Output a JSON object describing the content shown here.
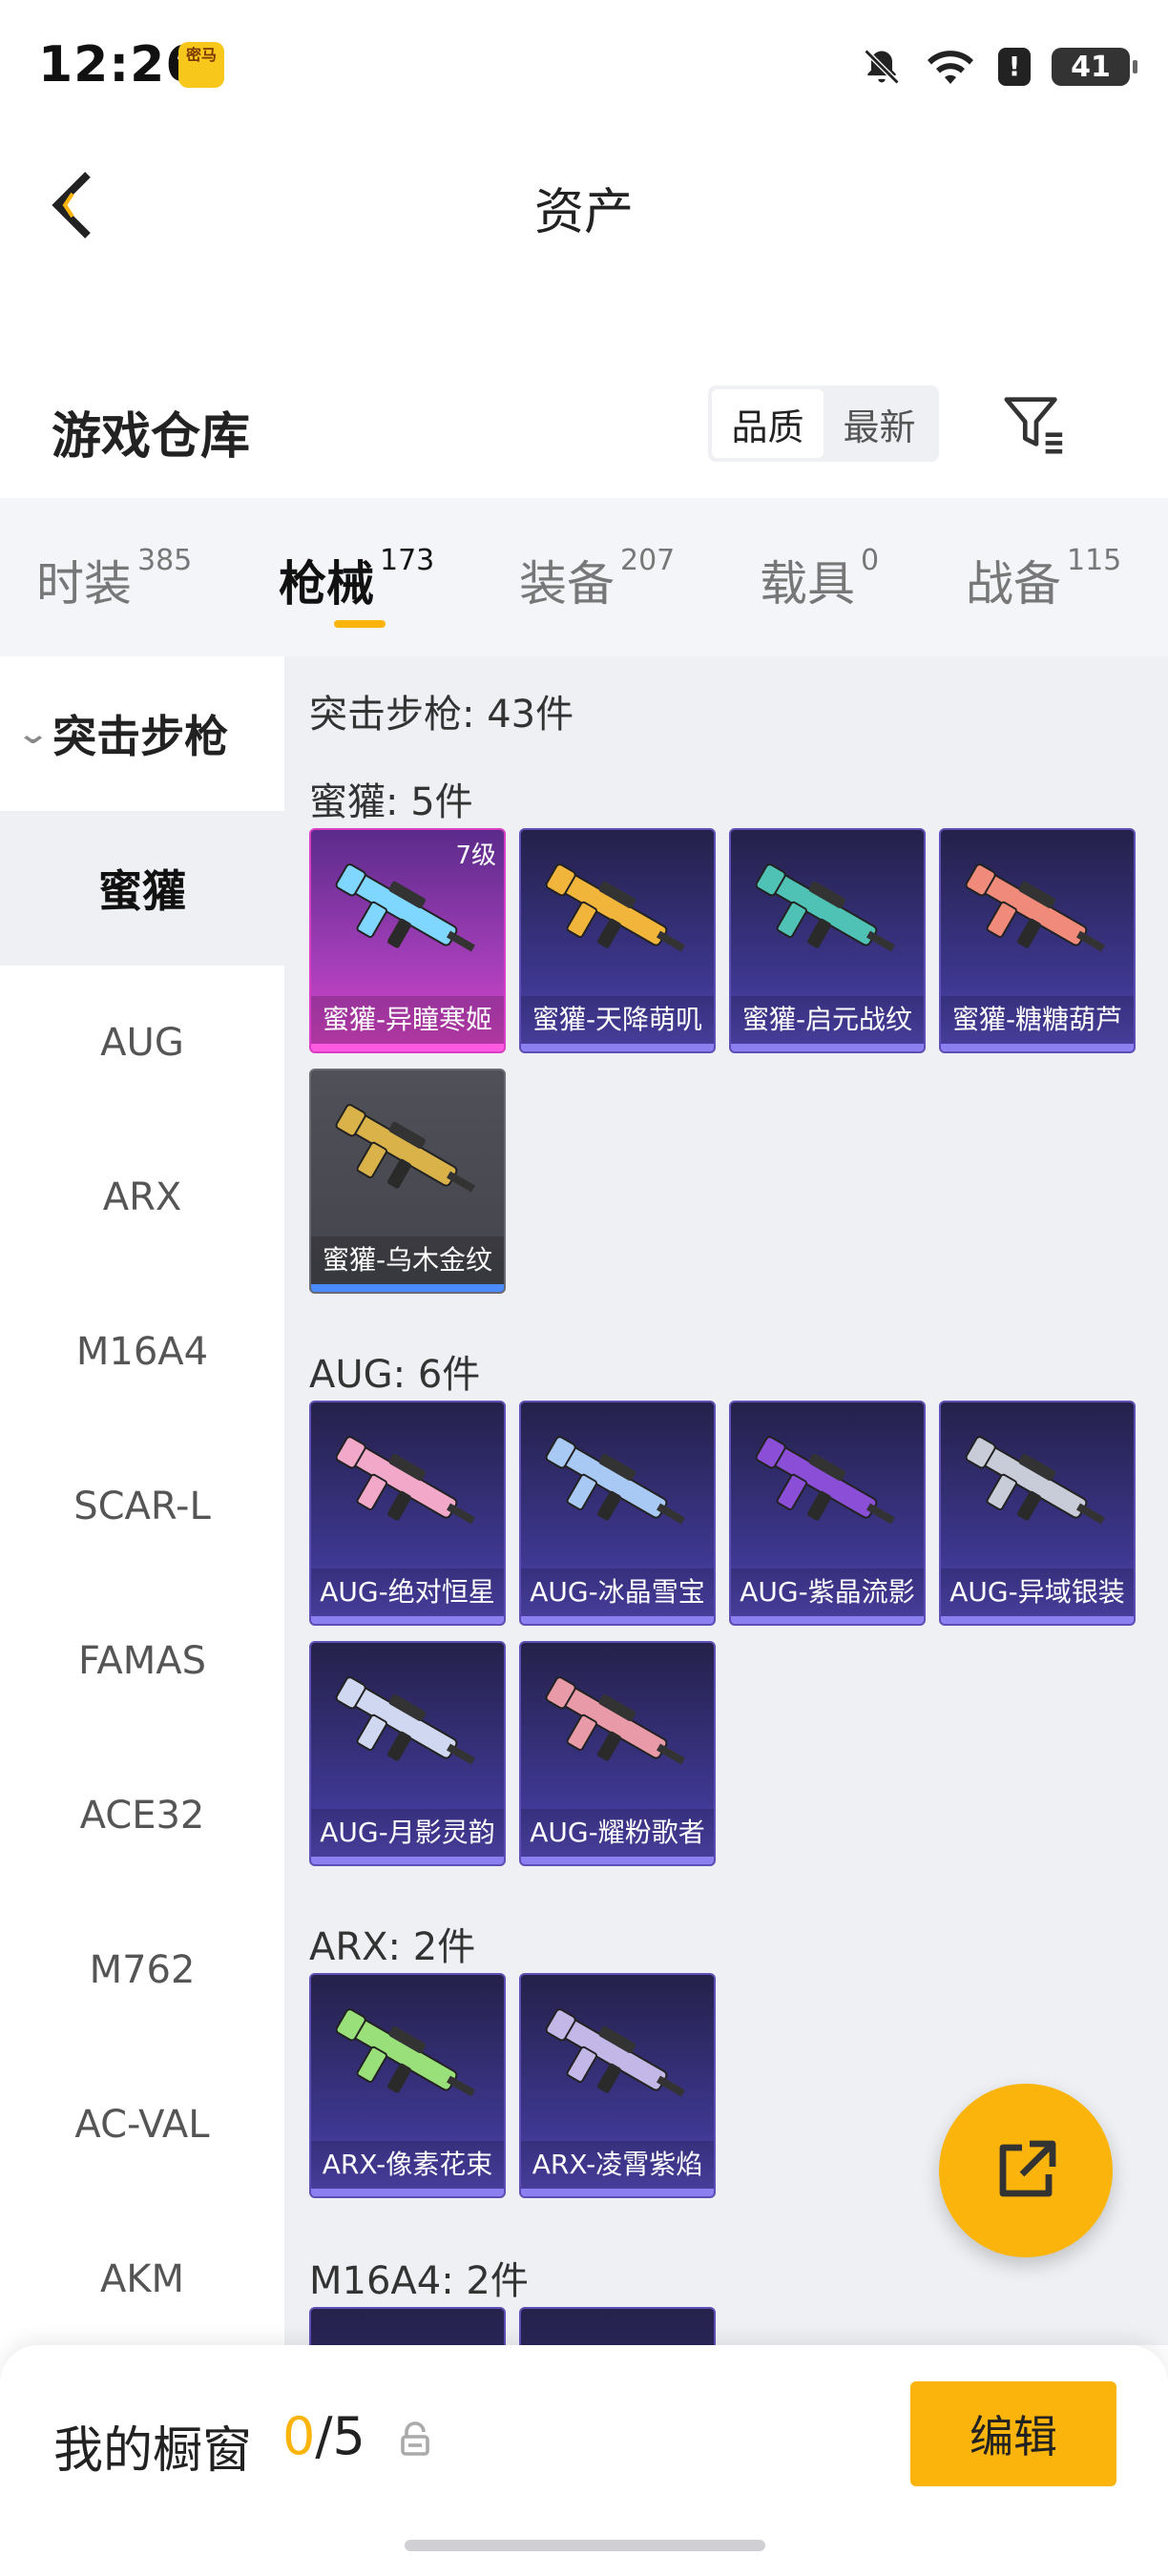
{
  "status": {
    "time": "12:26",
    "battery": "41",
    "app_badge": "密马"
  },
  "header": {
    "title": "资产"
  },
  "warehouse": {
    "title": "游戏仓库",
    "sort_options": [
      "品质",
      "最新"
    ]
  },
  "tabs": [
    {
      "label": "时装",
      "count": "385"
    },
    {
      "label": "枪械",
      "count": "173"
    },
    {
      "label": "装备",
      "count": "207"
    },
    {
      "label": "载具",
      "count": "0"
    },
    {
      "label": "战备",
      "count": "115"
    }
  ],
  "sidebar": {
    "group": "突击步枪",
    "items": [
      "蜜獾",
      "AUG",
      "ARX",
      "M16A4",
      "SCAR-L",
      "FAMAS",
      "ACE32",
      "M762",
      "AC-VAL",
      "AKM"
    ]
  },
  "main": {
    "summary": "突击步枪: 43件",
    "sections": [
      {
        "title": "蜜獾: 5件",
        "items": [
          {
            "label": "蜜獾-异瞳寒姬",
            "level": "7级",
            "rarity": "magenta",
            "color": "#7fd6ff"
          },
          {
            "label": "蜜獾-天降萌叽",
            "level": "",
            "rarity": "purple",
            "color": "#f2b53c"
          },
          {
            "label": "蜜獾-启元战纹",
            "level": "",
            "rarity": "purple",
            "color": "#4fc1b5"
          },
          {
            "label": "蜜獾-糖糖葫芦",
            "level": "",
            "rarity": "purple",
            "color": "#f08a7a"
          },
          {
            "label": "蜜獾-乌木金纹",
            "level": "",
            "rarity": "gray",
            "color": "#d9b24a"
          }
        ]
      },
      {
        "title": "AUG: 6件",
        "items": [
          {
            "label": "AUG-绝对恒星",
            "level": "",
            "rarity": "purple",
            "color": "#f2a9c9"
          },
          {
            "label": "AUG-冰晶雪宝",
            "level": "",
            "rarity": "purple",
            "color": "#a9c9f5"
          },
          {
            "label": "AUG-紫晶流影",
            "level": "",
            "rarity": "purple",
            "color": "#8a4fd6"
          },
          {
            "label": "AUG-异域银装",
            "level": "",
            "rarity": "purple",
            "color": "#c8ccd8"
          },
          {
            "label": "AUG-月影灵韵",
            "level": "",
            "rarity": "purple",
            "color": "#cfd8f0"
          },
          {
            "label": "AUG-耀粉歌者",
            "level": "",
            "rarity": "purple",
            "color": "#e89aa8"
          }
        ]
      },
      {
        "title": "ARX: 2件",
        "items": [
          {
            "label": "ARX-像素花束",
            "level": "",
            "rarity": "purple",
            "color": "#9ae07a"
          },
          {
            "label": "ARX-凌霄紫焰",
            "level": "",
            "rarity": "purple",
            "color": "#c3b7e8"
          }
        ]
      },
      {
        "title": "M16A4: 2件",
        "items": []
      }
    ]
  },
  "bottom": {
    "label": "我的橱窗",
    "current": "0",
    "sep_total": "/5",
    "edit": "编辑"
  },
  "colors": {
    "accent": "#fbb40b",
    "panel": "#eef0f3"
  }
}
